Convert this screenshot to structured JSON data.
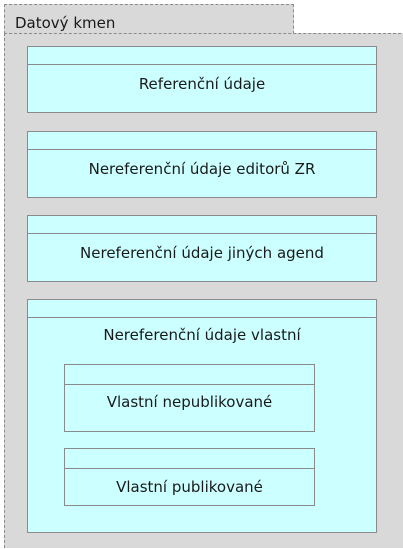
{
  "package": {
    "title": "Datový kmen"
  },
  "boxes": {
    "referencni": "Referenční údaje",
    "editori": "Nereferenční údaje editorů ZR",
    "jine_agendy": "Nereferenční údaje jiných agend",
    "vlastni": "Nereferenční údaje vlastní",
    "nepublikovane": "Vlastní nepublikované",
    "publikovane": "Vlastní publikované"
  },
  "colors": {
    "package_fill": "#d9d9d9",
    "box_fill": "#ccffff",
    "border": "#8a8a8a"
  }
}
